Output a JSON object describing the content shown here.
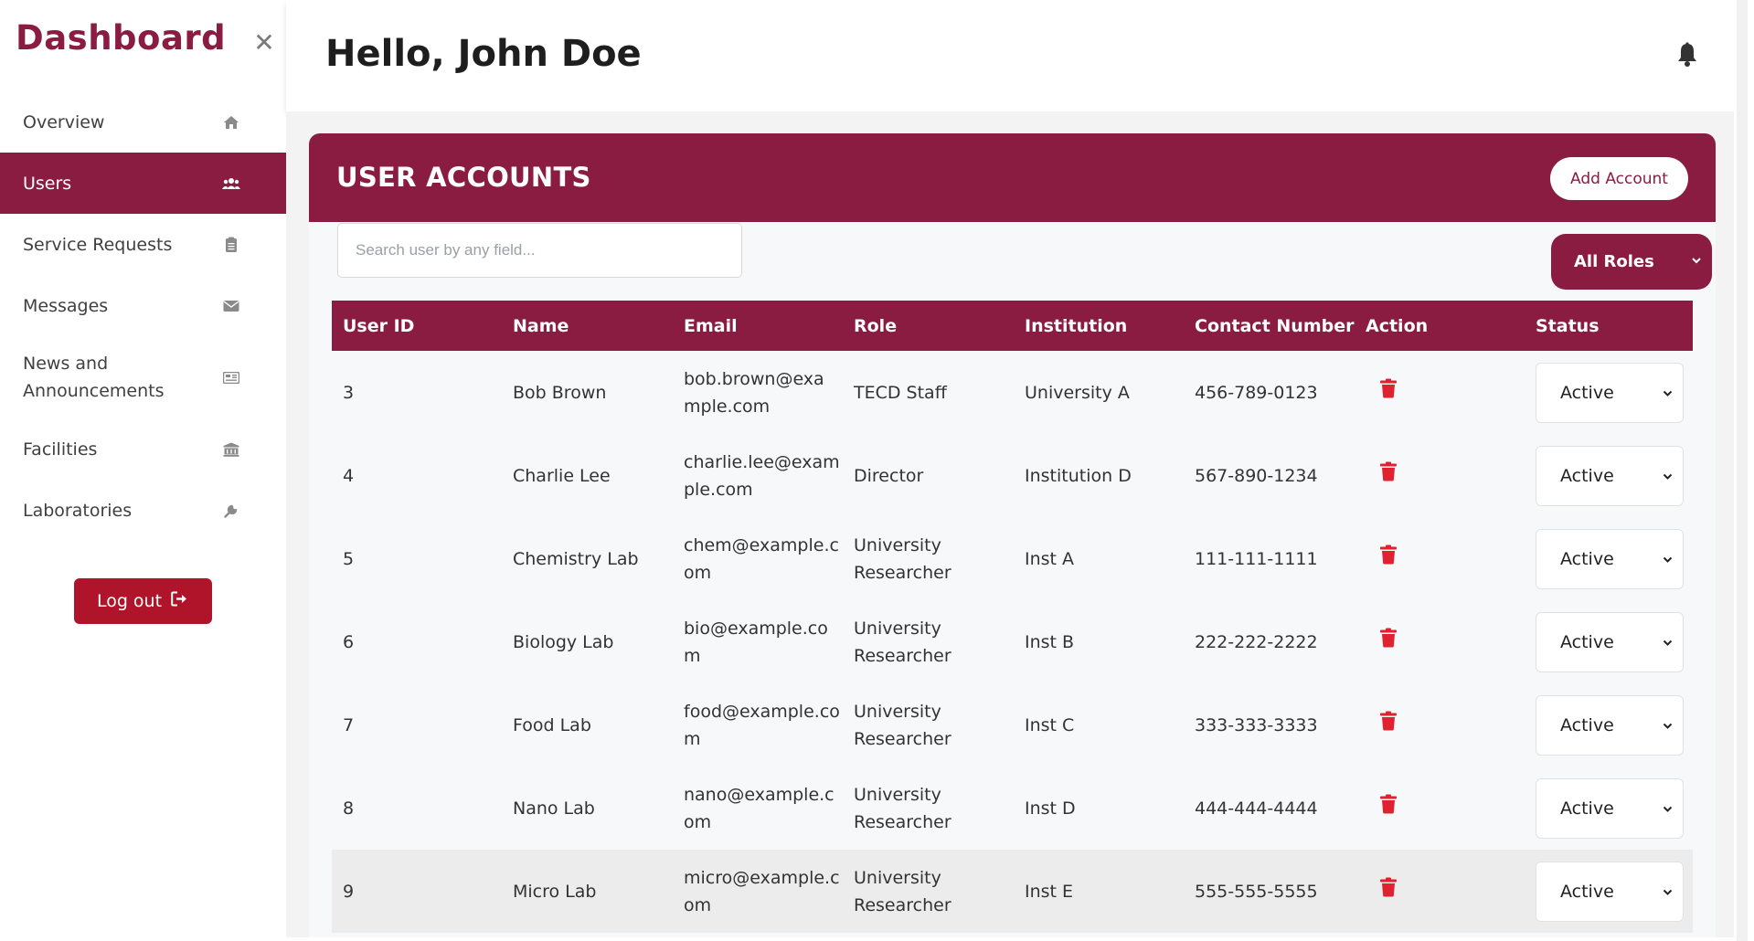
{
  "sidebar": {
    "brand": "Dashboard",
    "items": [
      {
        "label": "Overview",
        "icon": "home-icon"
      },
      {
        "label": "Users",
        "icon": "users-icon"
      },
      {
        "label": "Service Requests",
        "icon": "clipboard-icon"
      },
      {
        "label": "Messages",
        "icon": "envelope-icon"
      },
      {
        "label": "News and Announcements",
        "icon": "newspaper-icon"
      },
      {
        "label": "Facilities",
        "icon": "building-icon"
      },
      {
        "label": "Laboratories",
        "icon": "wrench-icon"
      }
    ],
    "logout_label": "Log out"
  },
  "header": {
    "greeting": "Hello, John Doe"
  },
  "accounts": {
    "title": "USER ACCOUNTS",
    "add_label": "Add Account",
    "search_placeholder": "Search user by any field...",
    "role_filter": "All Roles",
    "columns": [
      "User ID",
      "Name",
      "Email",
      "Role",
      "Institution",
      "Contact Number",
      "Action",
      "Status"
    ],
    "rows": [
      {
        "id": "3",
        "name": "Bob Brown",
        "email_1": "bob.brown@exa",
        "email_2": "mple.com",
        "role_1": "TECD Staff",
        "role_2": "",
        "institution": "University A",
        "contact": "456-789-0123",
        "status": "Active"
      },
      {
        "id": "4",
        "name": "Charlie Lee",
        "email_1": "charlie.lee@exam",
        "email_2": "ple.com",
        "role_1": "Director",
        "role_2": "",
        "institution": "Institution D",
        "contact": "567-890-1234",
        "status": "Active"
      },
      {
        "id": "5",
        "name": "Chemistry Lab",
        "email_1": "chem@example.c",
        "email_2": "om",
        "role_1": "University",
        "role_2": "Researcher",
        "institution": "Inst A",
        "contact": "111-111-1111",
        "status": "Active"
      },
      {
        "id": "6",
        "name": "Biology Lab",
        "email_1": "bio@example.co",
        "email_2": "m",
        "role_1": "University",
        "role_2": "Researcher",
        "institution": "Inst B",
        "contact": "222-222-2222",
        "status": "Active"
      },
      {
        "id": "7",
        "name": "Food Lab",
        "email_1": "food@example.co",
        "email_2": "m",
        "role_1": "University",
        "role_2": "Researcher",
        "institution": "Inst C",
        "contact": "333-333-3333",
        "status": "Active"
      },
      {
        "id": "8",
        "name": "Nano Lab",
        "email_1": "nano@example.c",
        "email_2": "om",
        "role_1": "University",
        "role_2": "Researcher",
        "institution": "Inst D",
        "contact": "444-444-4444",
        "status": "Active"
      },
      {
        "id": "9",
        "name": "Micro Lab",
        "email_1": "micro@example.c",
        "email_2": "om",
        "role_1": "University",
        "role_2": "Researcher",
        "institution": "Inst E",
        "contact": "555-555-5555",
        "status": "Active"
      }
    ]
  },
  "colors": {
    "brand": "#8b1c41",
    "logout": "#b0142b",
    "delete": "#e0212f"
  }
}
